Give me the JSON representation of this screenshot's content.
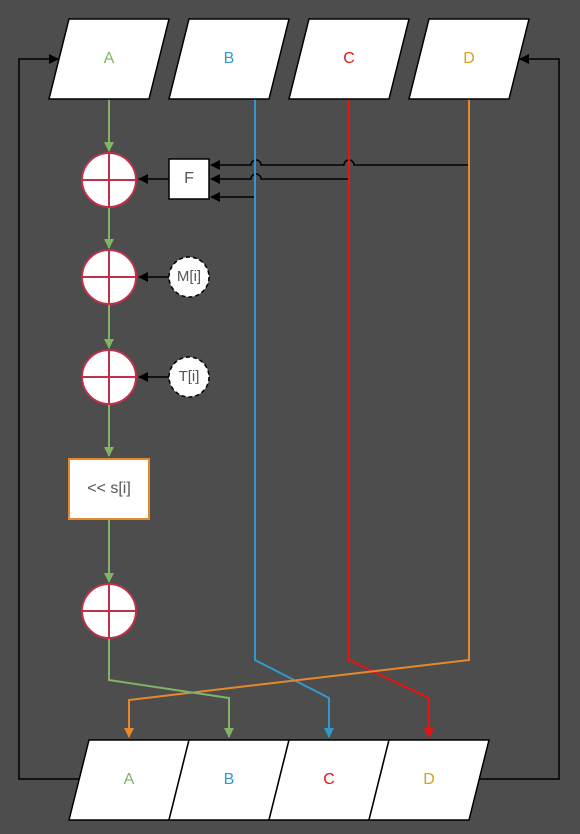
{
  "registers_top": [
    {
      "label": "A",
      "color": "#82b366"
    },
    {
      "label": "B",
      "color": "#3399cc"
    },
    {
      "label": "C",
      "color": "#ee1111"
    },
    {
      "label": "D",
      "color": "#d6a020"
    }
  ],
  "registers_bottom": [
    {
      "label": "A",
      "color": "#82b366"
    },
    {
      "label": "B",
      "color": "#3399cc"
    },
    {
      "label": "C",
      "color": "#ee1111"
    },
    {
      "label": "D",
      "color": "#d6a020"
    }
  ],
  "function_box": {
    "label": "F"
  },
  "message_input": {
    "label": "M[i]"
  },
  "constant_input": {
    "label": "T[i]"
  },
  "shift_box": {
    "label": "<< s[i]"
  },
  "colors": {
    "background": "#4d4d4d",
    "a_path": "#82b366",
    "b_path": "#3399cc",
    "c_path": "#ee1111",
    "d_path": "#e6882e",
    "adder_stroke": "#c0314a",
    "shift_border": "#e6882e",
    "feedback": "#000000"
  }
}
